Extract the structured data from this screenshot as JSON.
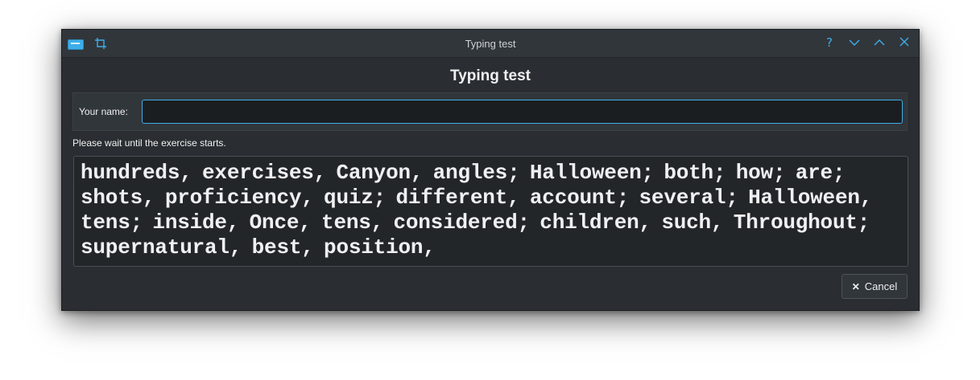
{
  "window": {
    "title": "Typing test",
    "buttons": {
      "help": "?",
      "minimize": "⌵",
      "maximize": "︿",
      "close": "✕"
    }
  },
  "dialog": {
    "heading": "Typing test",
    "name_label": "Your name:",
    "name_value": "",
    "status": "Please wait until the exercise starts.",
    "exercise_text": "hundreds, exercises, Canyon, angles; Halloween; both; how; are; shots, proficiency, quiz; different, account; several; Halloween, tens; inside, Once, tens, considered; children, such, Throughout; supernatural, best, position,",
    "cancel_label": "Cancel",
    "cancel_icon": "✕"
  },
  "colors": {
    "accent": "#3daee9",
    "background": "#2a2e32",
    "titlebar": "#31363b"
  },
  "icons": {
    "app": "keyboard-icon",
    "crop": "crop-icon"
  }
}
